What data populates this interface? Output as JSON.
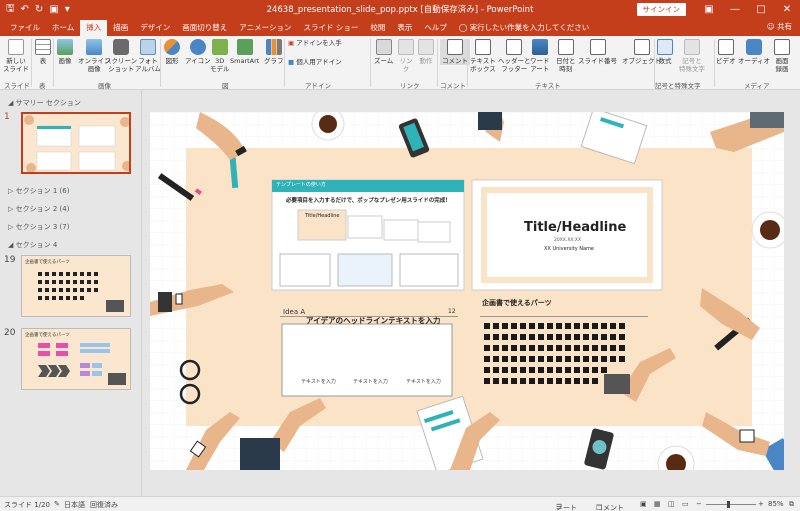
{
  "titlebar": {
    "title": "24638_presentation_slide_pop.pptx [自動保存済み] - PowerPoint",
    "signin": "サインイン"
  },
  "tabs": [
    "ファイル",
    "ホーム",
    "挿入",
    "描画",
    "デザイン",
    "画面切り替え",
    "アニメーション",
    "スライド ショー",
    "校閲",
    "表示",
    "ヘルプ"
  ],
  "tellme": "実行したい作業を入力してください",
  "share": "共有",
  "ribbon": {
    "new_slide": "新しい",
    "new_slide2": "スライド",
    "table": "表",
    "image": "画像",
    "online_image": "オンライン",
    "online_image2": "画像",
    "screenshot": "スクリーン",
    "screenshot2": "ショット",
    "photo_album": "フォト",
    "photo_album2": "アルバム",
    "shapes": "図形",
    "icons": "アイコン",
    "model3d": "3D",
    "model3d2": "モデル",
    "smartart": "SmartArt",
    "graph": "グラフ",
    "get_addins": "アドインを入手",
    "my_addins": "個人用アドイン",
    "zoom": "ズーム",
    "link": "リン",
    "link2": "ク",
    "action": "動作",
    "comment": "コメント",
    "textbox": "テキスト",
    "textbox2": "ボックス",
    "header_footer": "ヘッダーと",
    "header_footer2": "フッター",
    "wordart": "ワード",
    "wordart2": "アート",
    "datetime": "日付と",
    "datetime2": "時刻",
    "slide_number": "スライド番号",
    "object": "オブジェクト",
    "equation": "数式",
    "symbol": "記号と",
    "symbol2": "特殊文字",
    "video": "ビデオ",
    "audio": "オーディオ",
    "screen_record": "画面",
    "screen_record2": "録画",
    "groups": {
      "slide": "スライド",
      "table": "表",
      "image": "画像",
      "figure": "図",
      "addin": "アドイン",
      "link": "リンク",
      "comment": "コメント",
      "text": "テキスト",
      "symbols": "記号と特殊文字",
      "media": "メディア"
    }
  },
  "leftpane": {
    "summary_section": "サマリー セクション",
    "slide1_num": "1",
    "section1": "セクション 1 (6)",
    "section2": "セクション 2 (4)",
    "section3": "セクション 3 (7)",
    "section4": "セクション 4",
    "slide19_num": "19",
    "slide19_title": "企画書で使えるパーツ",
    "slide20_num": "20",
    "slide20_title": "企画書で使えるパーツ"
  },
  "slide": {
    "template_tag": "テンプレートの使い方",
    "template_heading": "必要項目を入力するだけで、ポップなプレゼン用スライドの完成！",
    "mini_title": "Title/Headline",
    "headline": "Title/Headline",
    "date": "20XX.XX.XX",
    "university": "XX University  Name",
    "idea_label": "Idea A",
    "idea_page": "12",
    "idea_heading": "アイデアのヘッドラインテキストを入力",
    "text1": "テキストを入力",
    "text2": "テキストを入力",
    "text3": "テキストを入力",
    "parts_heading": "企画書で使えるパーツ"
  },
  "status": {
    "slide_count": "スライド 1/20",
    "language": "日本語",
    "recovered": "回復済み",
    "notes": "ノート",
    "comment": "コメント",
    "zoom": "85%"
  },
  "colors": {
    "accent": "#c43e1c",
    "slide_band": "#fbe3c7",
    "teal": "#2fb3b8"
  }
}
